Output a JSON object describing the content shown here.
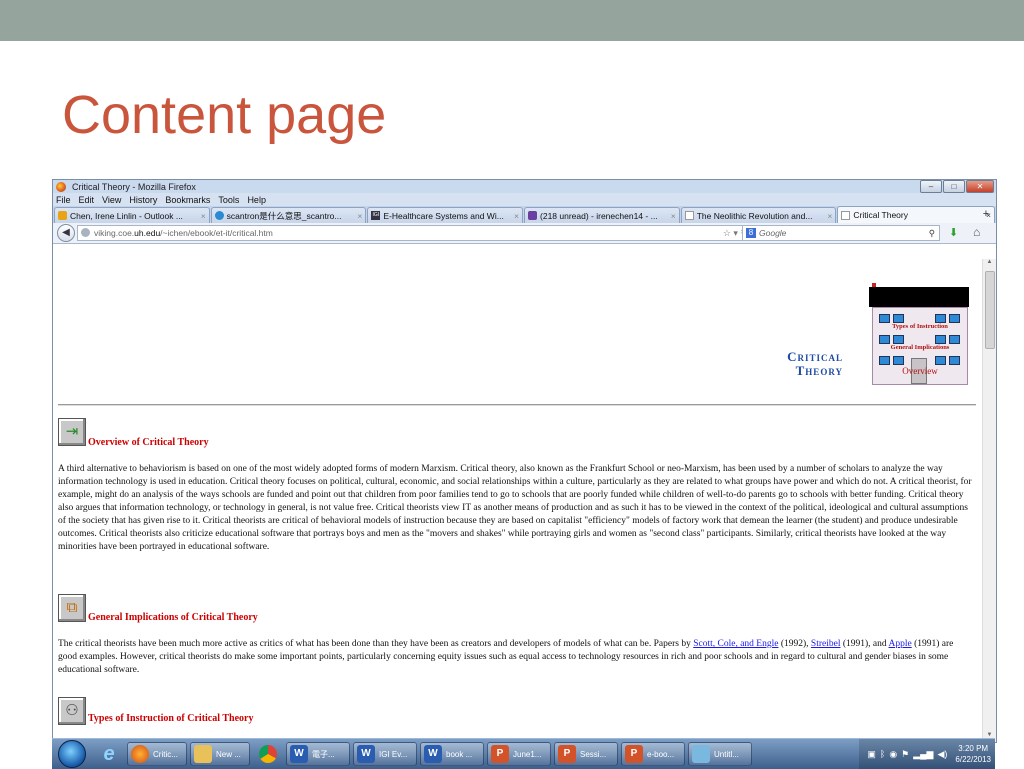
{
  "slide": {
    "title": "Content page",
    "colors": {
      "band": "#95a59e",
      "title": "#c9553c"
    }
  },
  "browser": {
    "window_title": "Critical Theory - Mozilla Firefox",
    "win_buttons": [
      "–",
      "□",
      "✕"
    ],
    "menu": [
      "File",
      "Edit",
      "View",
      "History",
      "Bookmarks",
      "Tools",
      "Help"
    ],
    "tabs": [
      {
        "label": "Chen, Irene Linlin - Outlook ...",
        "icon": "outlook-icon"
      },
      {
        "label": "scantron是什么意思_scantro...",
        "icon": "browser-page-icon"
      },
      {
        "label": "E-Healthcare Systems and Wi...",
        "icon": "igi-icon"
      },
      {
        "label": "(218 unread) - irenechen14 - ...",
        "icon": "mail-icon"
      },
      {
        "label": "The Neolithic Revolution and...",
        "icon": "page-icon"
      },
      {
        "label": "Critical Theory",
        "icon": "page-icon",
        "active": true
      }
    ],
    "new_tab": "+",
    "url": {
      "prefix": "viking.coe.",
      "domain": "uh.edu",
      "suffix": "/~ichen/ebook/et-it/critical.htm"
    },
    "search_placeholder": "Google"
  },
  "webpage": {
    "logo_line1": "Critical",
    "logo_line2": "Theory",
    "building_labels": [
      "Types of Instruction",
      "General Implications",
      "Overview"
    ],
    "sections": [
      {
        "title": "Overview of Critical Theory",
        "text": "A third alternative to behaviorism is based on one of the most widely adopted forms of modern Marxism. Critical theory, also known as the Frankfurt School or neo-Marxism, has been used by a number of scholars to analyze the way information technology is used in education. Critical theory focuses on political, cultural, economic, and social relationships within a culture, particularly as they are related to what groups have power and which do not. A critical theorist, for example, might do an analysis of the ways schools are funded and point out that children from poor families tend to go to schools that are poorly funded while children of well-to-do parents go to schools with better funding. Critical theory also argues that information technology, or technology in general, is not value free. Critical theorists view IT as another means of production and as such it has to be viewed in the context of the political, ideological and cultural assumptions of the society that has given rise to it. Critical theorists are critical of behavioral models of instruction because they are based on capitalist \"efficiency\" models of factory work that demean the learner (the student) and produce undesirable outcomes. Critical theorists also criticize educational software that portrays boys and men as the \"movers and shakes\" while portraying girls and women as \"second class\" participants. Similarly, critical theorists have looked at the way minorities have been portrayed in educational software."
      },
      {
        "title": "General Implications of Critical Theory",
        "text_a": "The critical theorists have been much more active as critics of what has been done than they have been as creators and developers of models of what can be. Papers by ",
        "link1": "Scott, Cole, and Engle",
        "text_b": " (1992), ",
        "link2": "Streibel",
        "text_c": " (1991), and ",
        "link3": "Apple",
        "text_d": " (1991) are good examples. However, critical theorists do make some important points, particularly concerning equity issues such as equal access to technology resources in rich and poor schools and in regard to cultural and gender biases in some educational software."
      },
      {
        "title": "Types of Instruction of Critical Theory"
      }
    ]
  },
  "taskbar": {
    "items": [
      {
        "label": "",
        "kind": "pinned",
        "icon": "ie-icon"
      },
      {
        "label": "Critic...",
        "kind": "btn",
        "icon": "firefox-icon"
      },
      {
        "label": "New ...",
        "kind": "btn",
        "icon": "folder-icon"
      },
      {
        "label": "",
        "kind": "pinned",
        "icon": "chrome-icon"
      },
      {
        "label": "電子...",
        "kind": "btn",
        "icon": "word-icon"
      },
      {
        "label": "IGI Ev...",
        "kind": "btn",
        "icon": "word-icon"
      },
      {
        "label": "book ...",
        "kind": "btn",
        "icon": "word-icon"
      },
      {
        "label": "June1...",
        "kind": "btn",
        "icon": "powerpoint-icon"
      },
      {
        "label": "Sessi...",
        "kind": "btn",
        "icon": "powerpoint-icon"
      },
      {
        "label": "e-boo...",
        "kind": "btn",
        "icon": "powerpoint-icon"
      },
      {
        "label": "Untitl...",
        "kind": "btn",
        "icon": "app-icon"
      }
    ],
    "time": "3:20 PM",
    "date": "6/22/2013"
  }
}
